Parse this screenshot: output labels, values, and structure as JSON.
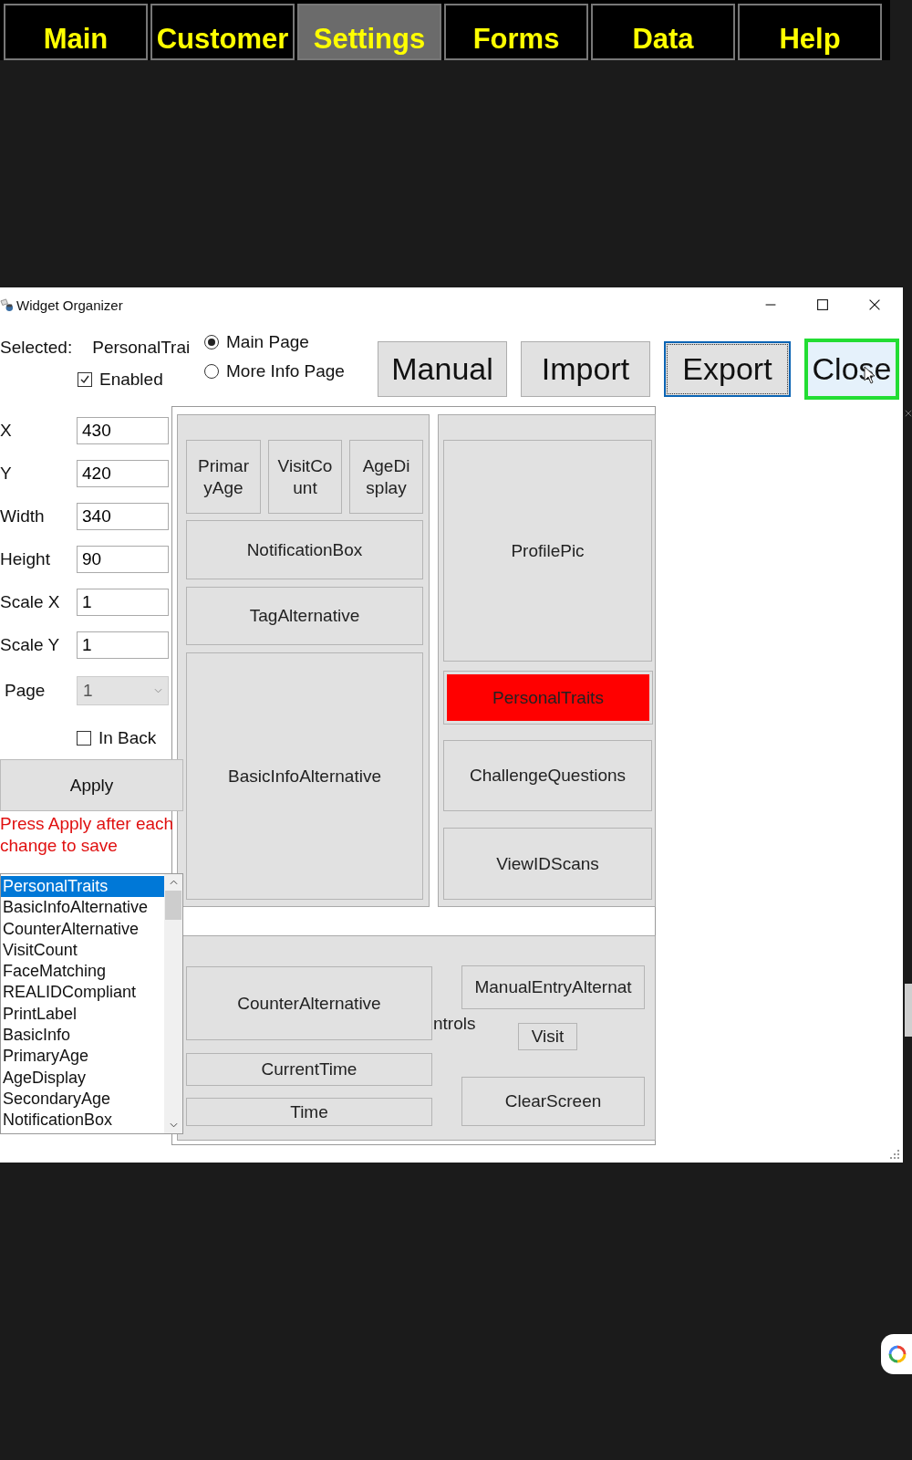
{
  "nav_tabs": [
    {
      "label": "Main",
      "selected": false
    },
    {
      "label": "Customer",
      "selected": false
    },
    {
      "label": "Settings",
      "selected": true
    },
    {
      "label": "Forms",
      "selected": false
    },
    {
      "label": "Data",
      "selected": false
    },
    {
      "label": "Help",
      "selected": false
    }
  ],
  "window": {
    "title": "Widget Organizer"
  },
  "selected": {
    "label": "Selected:",
    "value": "PersonalTrai"
  },
  "enabled": {
    "label": "Enabled",
    "checked": true
  },
  "page_options": [
    {
      "label": "Main Page",
      "selected": true
    },
    {
      "label": "More Info Page",
      "selected": false
    }
  ],
  "buttons": [
    {
      "label": "Manual",
      "kind": "plain"
    },
    {
      "label": "Import",
      "kind": "plain"
    },
    {
      "label": "Export",
      "kind": "focused"
    },
    {
      "label": "Close",
      "kind": "hovered"
    }
  ],
  "fields": [
    {
      "label": "X",
      "value": "430"
    },
    {
      "label": "Y",
      "value": "420"
    },
    {
      "label": "Width",
      "value": "340"
    },
    {
      "label": "Height",
      "value": "90"
    },
    {
      "label": "Scale X",
      "value": "1"
    },
    {
      "label": "Scale Y",
      "value": "1"
    }
  ],
  "page_select": {
    "label": "Page",
    "value": "1",
    "disabled": true
  },
  "in_back": {
    "label": "In Back",
    "checked": false
  },
  "apply_button": "Apply",
  "apply_note": "Press Apply after each change to save",
  "widget_list": [
    {
      "label": "PersonalTraits",
      "selected": true
    },
    {
      "label": "BasicInfoAlternative",
      "selected": false
    },
    {
      "label": "CounterAlternative",
      "selected": false
    },
    {
      "label": "VisitCount",
      "selected": false
    },
    {
      "label": "FaceMatching",
      "selected": false
    },
    {
      "label": "REALIDCompliant",
      "selected": false
    },
    {
      "label": "PrintLabel",
      "selected": false
    },
    {
      "label": "BasicInfo",
      "selected": false
    },
    {
      "label": "PrimaryAge",
      "selected": false
    },
    {
      "label": "AgeDisplay",
      "selected": false
    },
    {
      "label": "SecondaryAge",
      "selected": false
    },
    {
      "label": "NotificationBox",
      "selected": false
    }
  ],
  "canvas": {
    "widgets": [
      {
        "label": "PrimaryAge",
        "selected": false
      },
      {
        "label": "VisitCount",
        "selected": false
      },
      {
        "label": "AgeDisplay",
        "selected": false
      },
      {
        "label": "ProfilePic",
        "selected": false
      },
      {
        "label": "NotificationBox",
        "selected": false
      },
      {
        "label": "TagAlternative",
        "selected": false
      },
      {
        "label": "PersonalTraits",
        "selected": true
      },
      {
        "label": "BasicInfoAlternative",
        "selected": false
      },
      {
        "label": "ChallengeQuestions",
        "selected": false
      },
      {
        "label": "ViewIDScans",
        "selected": false
      },
      {
        "label": "ManualEntryAlternat",
        "selected": false
      },
      {
        "label": "CounterAlternative",
        "selected": false
      },
      {
        "label": "Visit",
        "selected": false
      },
      {
        "label": "CurrentTime",
        "selected": false
      },
      {
        "label": "ClearScreen",
        "selected": false
      },
      {
        "label": "Time",
        "selected": false
      }
    ],
    "partial_label": "ntrols"
  }
}
